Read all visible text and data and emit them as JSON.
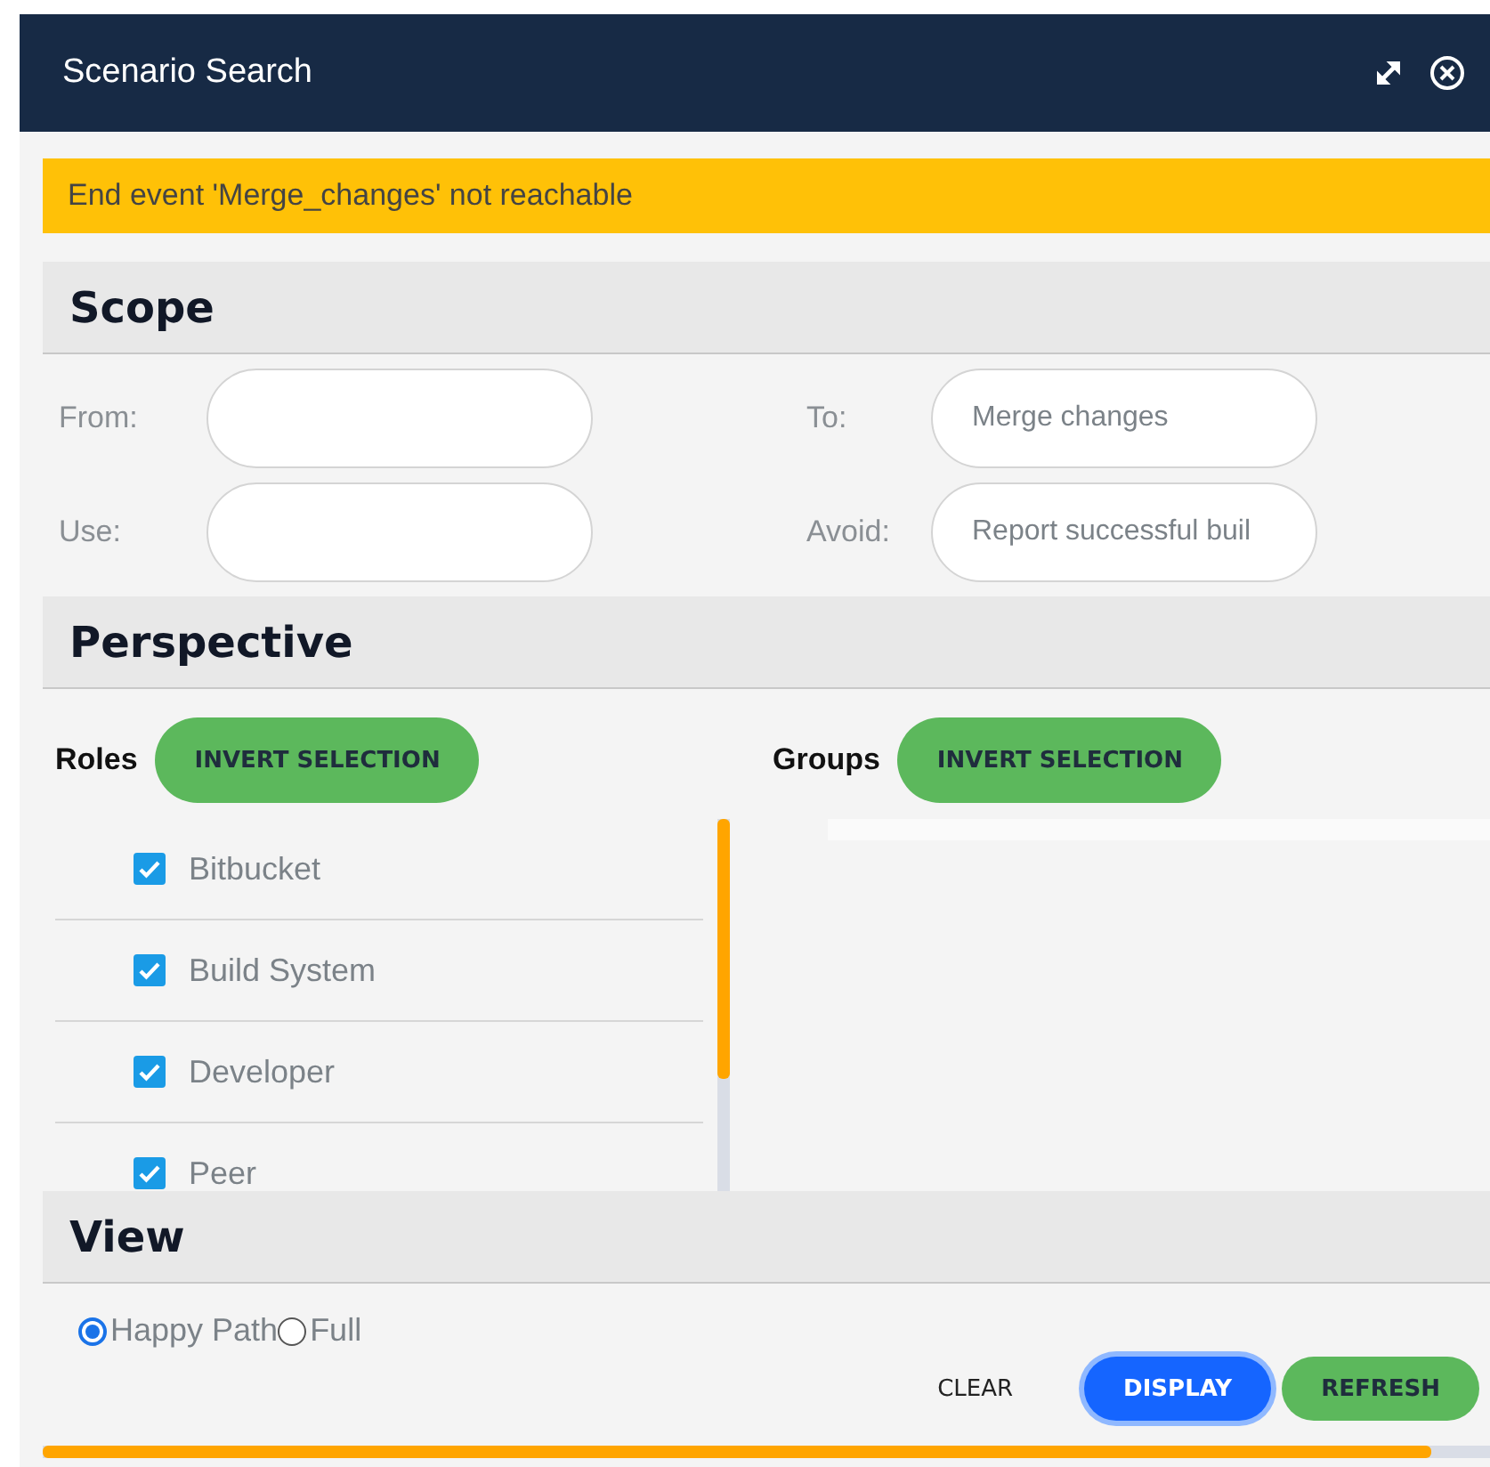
{
  "window": {
    "title": "Scenario Search"
  },
  "warning": "End event 'Merge_changes' not reachable",
  "scope": {
    "title": "Scope",
    "fields": [
      {
        "label": "From:"
      },
      {
        "label": "To:",
        "value": "Merge changes"
      },
      {
        "label": "Use:"
      },
      {
        "label": "Avoid:",
        "value": "Report successful buil"
      }
    ]
  },
  "perspective": {
    "title": "Perspective",
    "roles": {
      "label": "Roles",
      "button": "INVERT SELECTION",
      "items": [
        {
          "label": "Bitbucket",
          "checked": true
        },
        {
          "label": "Build System",
          "checked": true
        },
        {
          "label": "Developer",
          "checked": true
        },
        {
          "label": "Peer",
          "checked": true
        }
      ]
    },
    "groups": {
      "label": "Groups",
      "button": "INVERT SELECTION"
    }
  },
  "view": {
    "title": "View",
    "options": [
      {
        "label": "Happy Path",
        "selected": true
      },
      {
        "label": "Full",
        "selected": false
      }
    ]
  },
  "buttons": [
    {
      "label": "CLEAR",
      "kind": "plain"
    },
    {
      "label": "DISPLAY",
      "kind": "primary"
    },
    {
      "label": "REFRESH",
      "kind": "success"
    }
  ]
}
